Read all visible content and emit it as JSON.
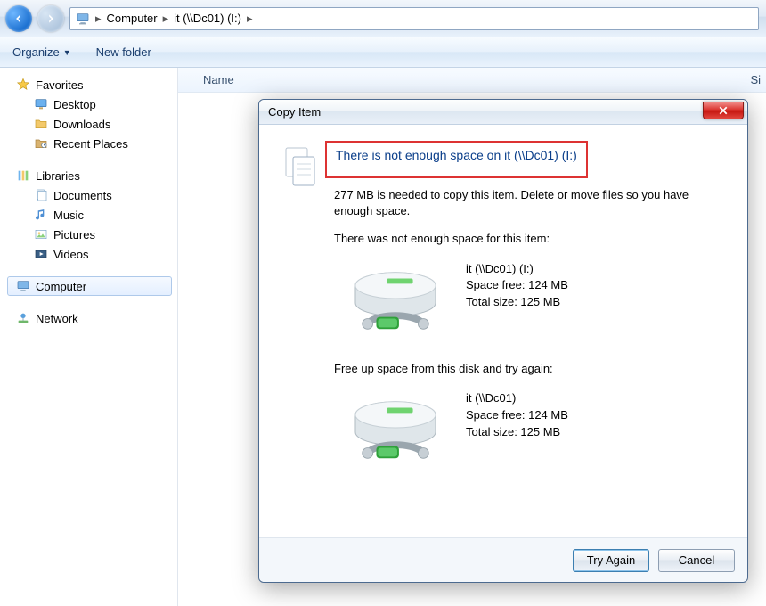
{
  "addressbar": {
    "root": "Computer",
    "path": "it (\\\\Dc01) (I:)"
  },
  "toolbar": {
    "organize": "Organize",
    "new_folder": "New folder"
  },
  "columns": {
    "name": "Name",
    "size_trunc": "Si"
  },
  "sidebar": {
    "favorites": "Favorites",
    "desktop": "Desktop",
    "downloads": "Downloads",
    "recent": "Recent Places",
    "libraries": "Libraries",
    "documents": "Documents",
    "music": "Music",
    "pictures": "Pictures",
    "videos": "Videos",
    "computer": "Computer",
    "network": "Network"
  },
  "dialog": {
    "title": "Copy Item",
    "headline": "There is not enough space on it (\\\\Dc01) (I:)",
    "need_line": "277 MB is needed to copy this item. Delete or move files so you have enough space.",
    "not_enough_line": "There was not enough space for this item:",
    "drive1": {
      "name": "it (\\\\Dc01) (I:)",
      "free": "Space free: 124 MB",
      "total": "Total size: 125 MB"
    },
    "free_up_line": "Free up space from this disk and try again:",
    "drive2": {
      "name": "it (\\\\Dc01)",
      "free": "Space free: 124 MB",
      "total": "Total size: 125 MB"
    },
    "try_again": "Try Again",
    "cancel": "Cancel"
  }
}
